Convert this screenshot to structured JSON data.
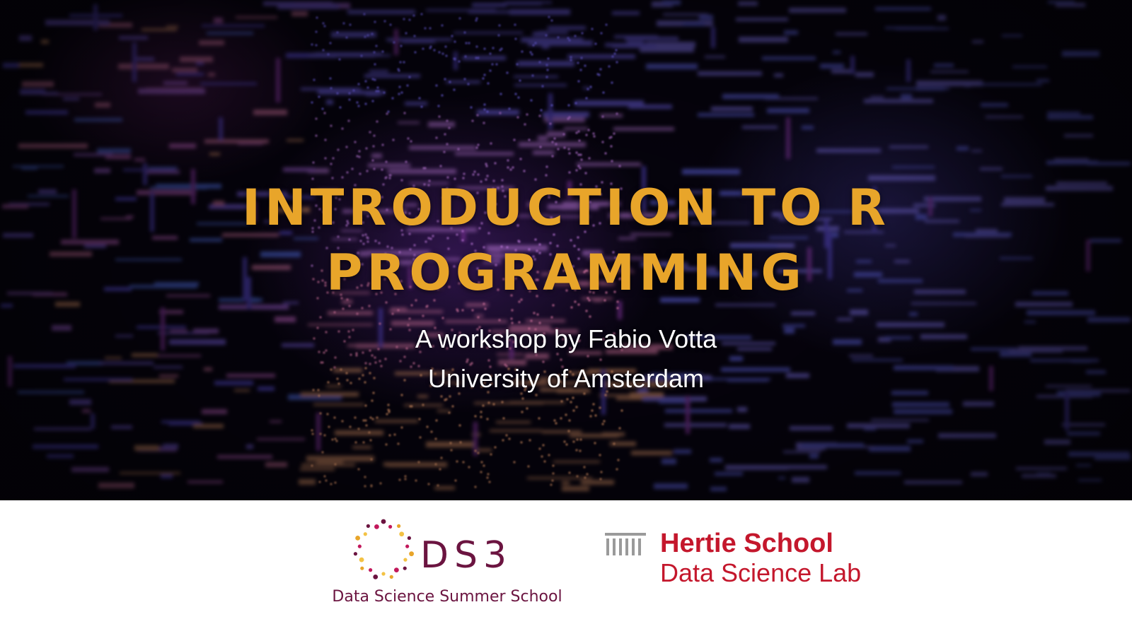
{
  "banner": {
    "title_line1": "INTRODUCTION TO R",
    "title_line2": "PROGRAMMING",
    "subtitle_line1": "A workshop by Fabio Votta",
    "subtitle_line2": "University of Amsterdam",
    "colors": {
      "title": "#e8a52a",
      "subtitle": "#ffffff",
      "background": "#06030e"
    }
  },
  "footer": {
    "ds3": {
      "logo_text": "DS3",
      "caption": "Data Science Summer School",
      "colors": {
        "text": "#6b1440",
        "dots": [
          "#6b1440",
          "#c2185b",
          "#e8a52a",
          "#f3c244"
        ]
      }
    },
    "hertie": {
      "name": "Hertie School",
      "lab": "Data Science Lab",
      "colors": {
        "text": "#c4172c",
        "mark": "#9a9a9a"
      }
    }
  }
}
